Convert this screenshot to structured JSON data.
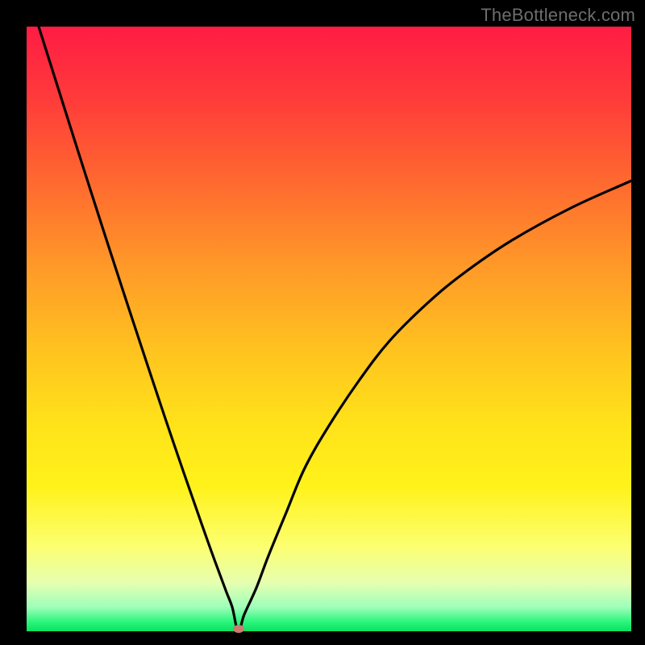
{
  "watermark": "TheBottleneck.com",
  "chart_data": {
    "type": "line",
    "title": "",
    "subtitle": "",
    "xlabel": "",
    "ylabel": "",
    "xlim": [
      0,
      100
    ],
    "ylim": [
      0,
      100
    ],
    "grid": false,
    "legend": false,
    "annotations": [],
    "background_gradient": {
      "top_color": "#ff1c44",
      "mid_color": "#ffe31a",
      "bottom_color": "#0be060"
    },
    "min_point": {
      "x": 35,
      "y": 0
    },
    "series": [
      {
        "name": "bottleneck-curve",
        "color": "#000000",
        "x": [
          2,
          5,
          8,
          11,
          14,
          17,
          20,
          23,
          26,
          29,
          31,
          33,
          34,
          35,
          36,
          38,
          40,
          43,
          46,
          50,
          55,
          60,
          66,
          72,
          80,
          90,
          100
        ],
        "y": [
          100,
          90.5,
          81,
          71.6,
          62.3,
          53.1,
          44,
          35,
          26.2,
          17.6,
          12,
          6.6,
          4,
          0,
          2.8,
          7.2,
          12.5,
          19.8,
          27,
          34,
          41.5,
          48,
          54,
          59,
          64.5,
          70,
          74.5
        ]
      }
    ]
  }
}
